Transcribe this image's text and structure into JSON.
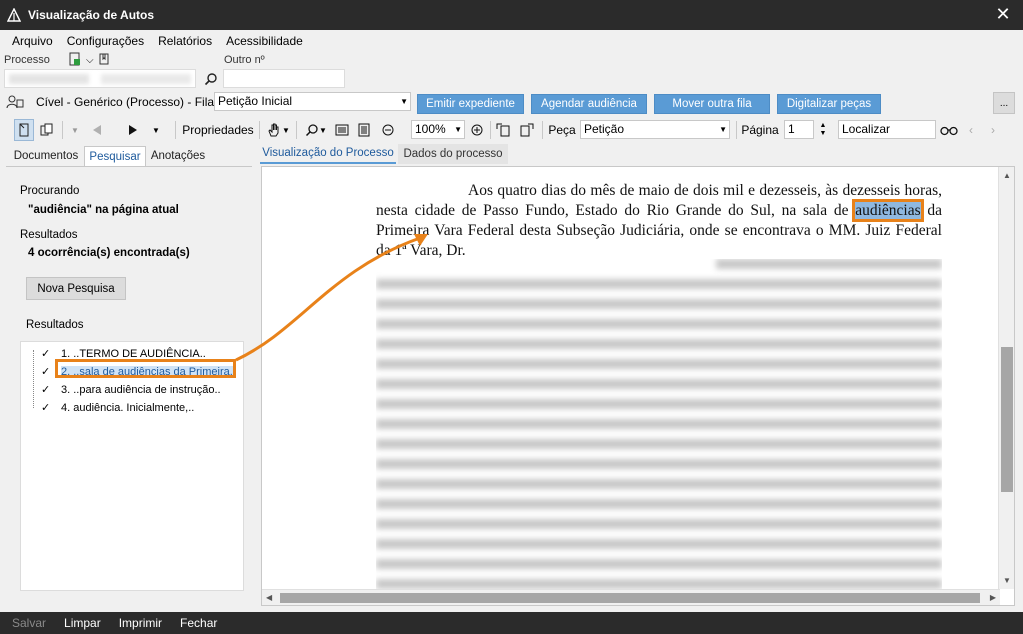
{
  "window": {
    "title": "Visualização de Autos"
  },
  "menu": {
    "items": [
      "Arquivo",
      "Configurações",
      "Relatórios",
      "Acessibilidade"
    ]
  },
  "process": {
    "label": "Processo",
    "other_label": "Outro nº",
    "value": "",
    "other_value": ""
  },
  "fila": {
    "label": "Cível - Genérico (Processo) - Fila:",
    "selected": "Petição Inicial"
  },
  "actions": {
    "emitir": "Emitir expediente",
    "agendar": "Agendar audiência",
    "mover": "Mover outra fila",
    "digitalizar": "Digitalizar peças",
    "more": "..."
  },
  "toolbar": {
    "propriedades": "Propriedades",
    "zoom": "100%",
    "peca_label": "Peça",
    "peca_value": "Petição",
    "pagina_label": "Página",
    "pagina_value": "1",
    "localizar_placeholder": "Localizar"
  },
  "left_tabs": [
    "Documentos",
    "Pesquisar",
    "Anotações"
  ],
  "search": {
    "procurando_label": "Procurando",
    "procurando_value": "\"audiência\" na página atual",
    "resultados_label": "Resultados",
    "count_text": "4 ocorrência(s) encontrada(s)",
    "nova_button": "Nova Pesquisa",
    "results_label": "Resultados",
    "results": [
      "1. ..TERMO DE AUDIÊNCIA..",
      "2. ..sala de audiências da Primeira..",
      "3. ..para audiência de instrução..",
      "4. audiência. Inicialmente,.."
    ]
  },
  "doc_tabs": [
    "Visualização do Processo",
    "Dados do processo"
  ],
  "document": {
    "line1": "Aos quatro dias do mês de maio de dois mil e dezesseis, às dezesseis horas, nesta cidade de Passo Fundo, Estado do Rio Grande do Sul, na sala de ",
    "highlight": "audiências",
    "line2": " da Primeira Vara Federal desta Subseção Judiciária, onde se encontrava o MM. Juiz Federal da 1ª Vara, Dr."
  },
  "bottom": {
    "salvar": "Salvar",
    "limpar": "Limpar",
    "imprimir": "Imprimir",
    "fechar": "Fechar"
  },
  "colors": {
    "accent": "#5a9bd5",
    "annotation": "#e8821a",
    "titlebar": "#2b2b2b"
  }
}
